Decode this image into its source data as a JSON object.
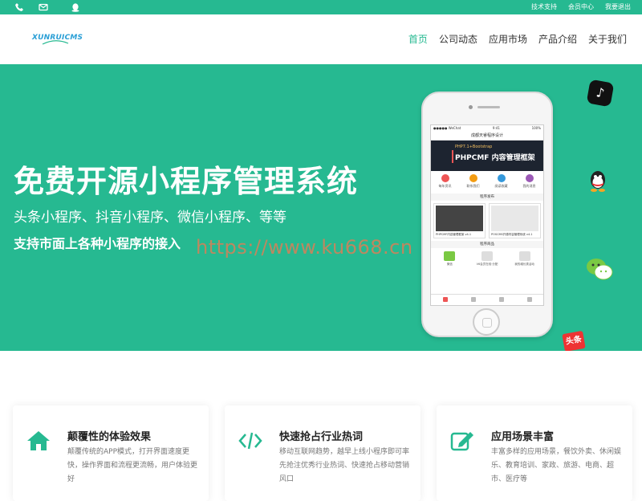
{
  "topbar": {
    "icons": [
      "phone-icon",
      "mail-icon",
      "qq-icon"
    ],
    "links": [
      "技术支持",
      "会员中心",
      "我要退出"
    ]
  },
  "header": {
    "logo_text": "XUNRUICMS",
    "nav": [
      "首页",
      "公司动态",
      "应用市场",
      "产品介绍",
      "关于我们"
    ],
    "active_nav": "首页"
  },
  "hero": {
    "title": "免费开源小程序管理系统",
    "subtitle": "头条小程序、抖音小程序、微信小程序、等等",
    "tagline": "支持市面上各种小程序的接入",
    "watermark": "https://www.ku668.cn"
  },
  "phone_screen": {
    "status_left": "●●●●● WeChat",
    "status_time": "9:41",
    "status_right": "100%",
    "title": "成都天睿程序设计",
    "banner_small": "PHP7.1+Bootstrap",
    "banner_big": "PHPCMF 内容管理框架",
    "icons": [
      "每年资讯",
      "联系我们",
      "阅读收藏",
      "我的消息"
    ],
    "section1": "程序发布",
    "cards": [
      "PHPCMF内容管理框架 v4.1",
      "POSCMS开源内容管理系统 v4.1"
    ],
    "section2": "程序商品",
    "apps": [
      "微信",
      "V6会员在线·分配",
      "我的增长类活动"
    ]
  },
  "floating_icons": [
    "tiktok-icon",
    "qq-icon",
    "wechat-icon",
    "toutiao-icon"
  ],
  "toutiao_label": "头条",
  "features": [
    {
      "icon": "home-icon",
      "title": "颠覆性的体验效果",
      "desc": "颠覆传统的APP模式，打开界面速度更快，操作界面和流程更流畅，用户体验更好"
    },
    {
      "icon": "code-icon",
      "title": "快速抢占行业热词",
      "desc": "移动互联网趋势，越早上线小程序即可率先抢注优秀行业热词、快速抢占移动营销风口"
    },
    {
      "icon": "edit-icon",
      "title": "应用场景丰富",
      "desc": "丰富多样的应用场景，餐饮外卖、休闲娱乐、教育培训、家政、旅游、电商、超市、医疗等"
    }
  ],
  "colors": {
    "brand": "#26b991",
    "logo": "#2a9fd6"
  }
}
